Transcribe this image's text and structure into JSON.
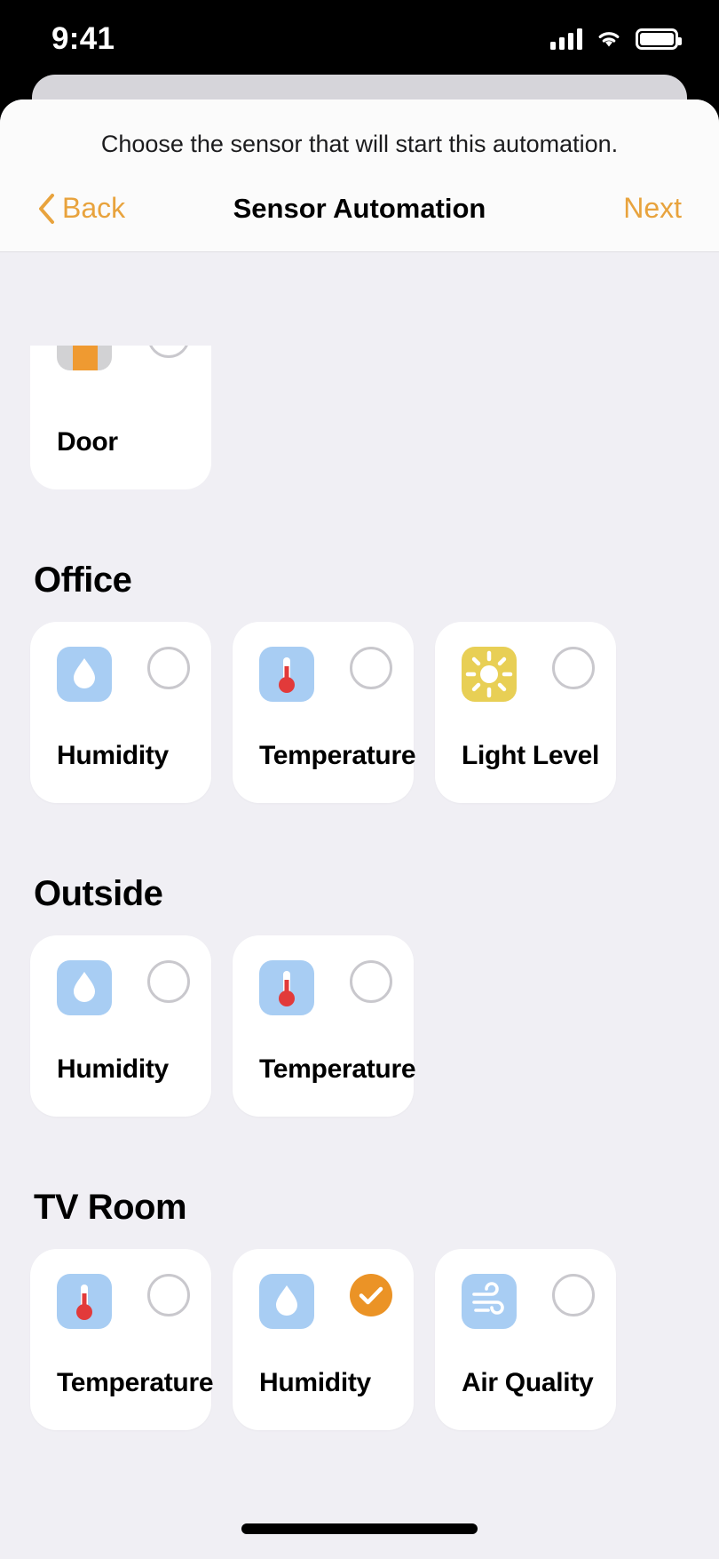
{
  "status_bar": {
    "time": "9:41",
    "icons": [
      "cellular-signal-icon",
      "wifi-icon",
      "battery-icon"
    ]
  },
  "sheet": {
    "prompt": "Choose the sensor that will start this automation.",
    "nav": {
      "back_label": "Back",
      "title": "Sensor Automation",
      "next_label": "Next"
    }
  },
  "colors": {
    "accent": "#e8a33d",
    "selected": "#eb9326",
    "page_background": "#f0eff4",
    "card_background": "#ffffff",
    "icon_blue": "#a8cdf3",
    "icon_yellow": "#e8cf55",
    "icon_gray": "#d2d2d4",
    "door_orange": "#ef9a31",
    "thermometer_red": "#e23a3a"
  },
  "sections": [
    {
      "title": "",
      "partial": true,
      "items": [
        {
          "label": "Door",
          "icon": "door-icon",
          "icon_style": "gray",
          "selected": false
        }
      ]
    },
    {
      "title": "Office",
      "partial": false,
      "items": [
        {
          "label": "Humidity",
          "icon": "humidity-droplet-icon",
          "icon_style": "blue",
          "selected": false
        },
        {
          "label": "Temperature",
          "icon": "thermometer-icon",
          "icon_style": "blue",
          "selected": false
        },
        {
          "label": "Light Level",
          "icon": "sun-icon",
          "icon_style": "yellow",
          "selected": false
        }
      ]
    },
    {
      "title": "Outside",
      "partial": false,
      "items": [
        {
          "label": "Humidity",
          "icon": "humidity-droplet-icon",
          "icon_style": "blue",
          "selected": false
        },
        {
          "label": "Temperature",
          "icon": "thermometer-icon",
          "icon_style": "blue",
          "selected": false
        }
      ]
    },
    {
      "title": "TV Room",
      "partial": false,
      "items": [
        {
          "label": "Temperature",
          "icon": "thermometer-icon",
          "icon_style": "blue",
          "selected": false
        },
        {
          "label": "Humidity",
          "icon": "humidity-droplet-icon",
          "icon_style": "blue",
          "selected": true
        },
        {
          "label": "Air Quality",
          "icon": "wind-icon",
          "icon_style": "blue",
          "selected": false
        }
      ]
    }
  ]
}
